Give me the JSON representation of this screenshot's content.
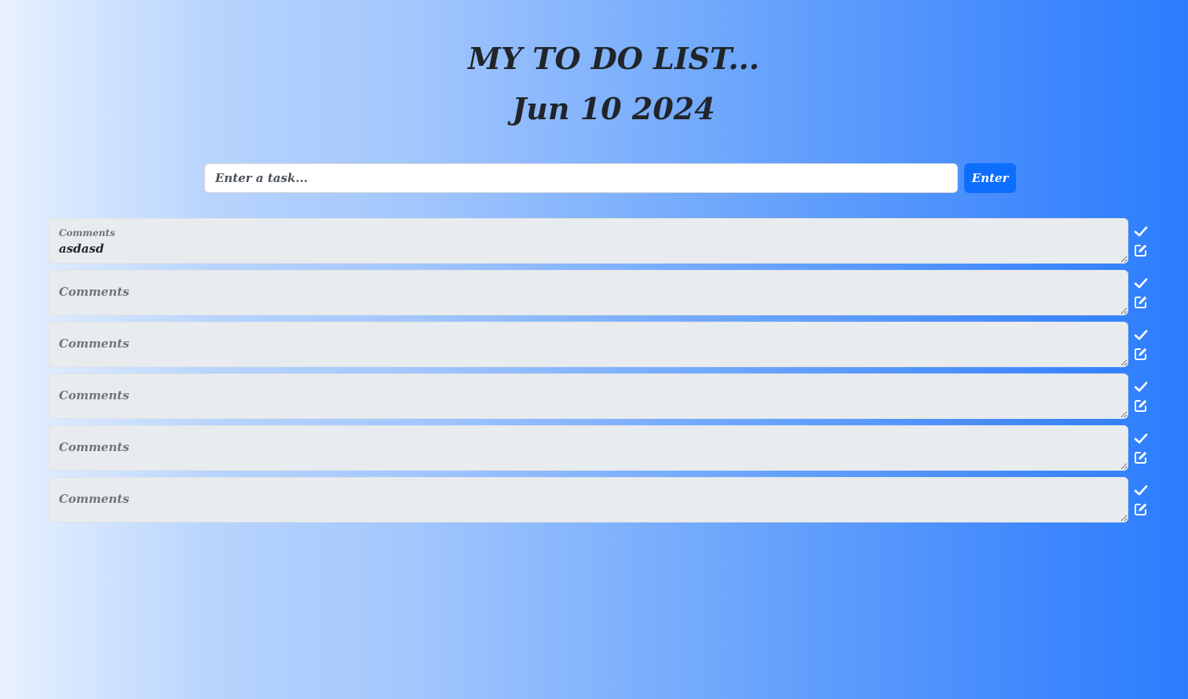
{
  "header": {
    "title": "MY TO DO LIST...",
    "date": "Jun 10 2024"
  },
  "form": {
    "input_placeholder": "Enter a task...",
    "input_value": "",
    "enter_label": "Enter"
  },
  "tasks": [
    {
      "label": "Comments",
      "value": "asdasd"
    },
    {
      "label": "Comments",
      "value": ""
    },
    {
      "label": "Comments",
      "value": ""
    },
    {
      "label": "Comments",
      "value": ""
    },
    {
      "label": "Comments",
      "value": ""
    },
    {
      "label": "Comments",
      "value": ""
    }
  ],
  "icons": {
    "complete": "check-icon",
    "edit": "edit-icon"
  },
  "colors": {
    "accent": "#0d6efd",
    "gradient_start": "#e8f1fe",
    "gradient_end": "#2b7dfd",
    "field_background": "#e9ecef"
  }
}
